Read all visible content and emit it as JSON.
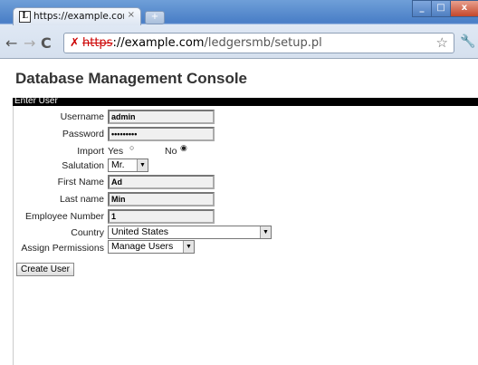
{
  "browser": {
    "tab_title": "https://example.com/ledge",
    "tab_close": "×",
    "new_tab": "+",
    "window_buttons": [
      "_",
      "□",
      "x"
    ],
    "url_scheme": "https",
    "url_host": "://example.com",
    "url_path": "/ledgersmb/setup.pl"
  },
  "page": {
    "title": "Database Management Console",
    "section": "Enter User"
  },
  "form": {
    "username_label": "Username",
    "username_value": "admin",
    "password_label": "Password",
    "password_value": "•••••••••",
    "import_label": "Import",
    "import_yes": "Yes",
    "import_no": "No",
    "import_selected": "No",
    "salutation_label": "Salutation",
    "salutation_value": "Mr.",
    "first_name_label": "First Name",
    "first_name_value": "Ad",
    "last_name_label": "Last name",
    "last_name_value": "Min",
    "employee_number_label": "Employee Number",
    "employee_number_value": "1",
    "country_label": "Country",
    "country_value": "United States",
    "permissions_label": "Assign Permissions",
    "permissions_value": "Manage Users",
    "submit_label": "Create User"
  }
}
